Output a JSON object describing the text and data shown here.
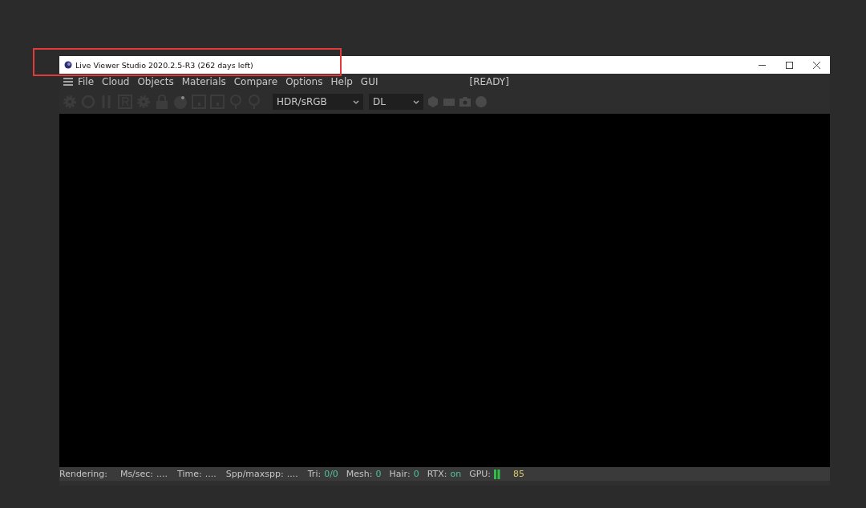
{
  "window": {
    "title": "Live Viewer Studio 2020.2.5-R3 (262 days left)"
  },
  "menu": [
    "File",
    "Cloud",
    "Objects",
    "Materials",
    "Compare",
    "Options",
    "Help",
    "GUI"
  ],
  "status_text": "[READY]",
  "toolbar": {
    "dropdowns": [
      {
        "value": "HDR/sRGB"
      },
      {
        "value": "DL"
      }
    ]
  },
  "status_bar": [
    {
      "label": "Rendering:",
      "kind": "text"
    },
    {
      "label": "Ms/sec:",
      "value": "....",
      "kind": "text"
    },
    {
      "label": "Time:",
      "value": "....",
      "kind": "text"
    },
    {
      "label": "Spp/maxspp:",
      "value": "....",
      "kind": "text"
    },
    {
      "label": "Tri:",
      "value": "0/0",
      "kind": "stat"
    },
    {
      "label": "Mesh:",
      "value": "0",
      "kind": "stat"
    },
    {
      "label": "Hair:",
      "value": "0",
      "kind": "stat"
    },
    {
      "label": "RTX:",
      "value": "on",
      "kind": "stat"
    },
    {
      "label": "GPU:",
      "value": "85",
      "kind": "gpu"
    }
  ]
}
